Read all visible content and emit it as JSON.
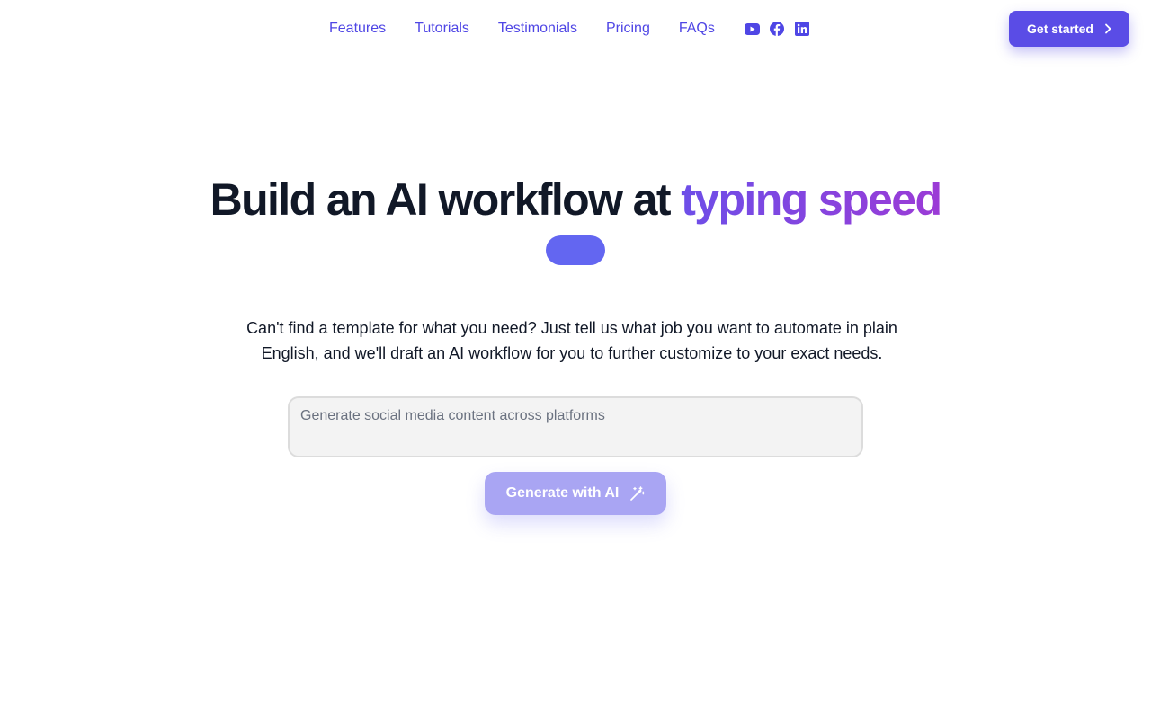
{
  "nav": {
    "links": [
      "Features",
      "Tutorials",
      "Testimonials",
      "Pricing",
      "FAQs"
    ],
    "socials": [
      {
        "icon": "youtube-icon"
      },
      {
        "icon": "facebook-icon"
      },
      {
        "icon": "linkedin-icon"
      }
    ],
    "cta_label": "Get started"
  },
  "hero": {
    "title_plain": "Build an AI workflow at ",
    "title_highlight": "typing speed",
    "description": "Can't find a template for what you need? Just tell us what job you want to automate in plain English, and we'll draft an AI workflow for you to further customize to your exact needs.",
    "input_placeholder": "Generate social media content across platforms",
    "input_value": "",
    "generate_label": "Generate with AI"
  },
  "colors": {
    "accent": "#5a4ce6",
    "link": "#4f46e5",
    "gradient_start": "#6d4ee8",
    "gradient_end": "#9b3bd6",
    "pill": "#6366f1",
    "generate_button_disabled": "#a9a5f3"
  }
}
